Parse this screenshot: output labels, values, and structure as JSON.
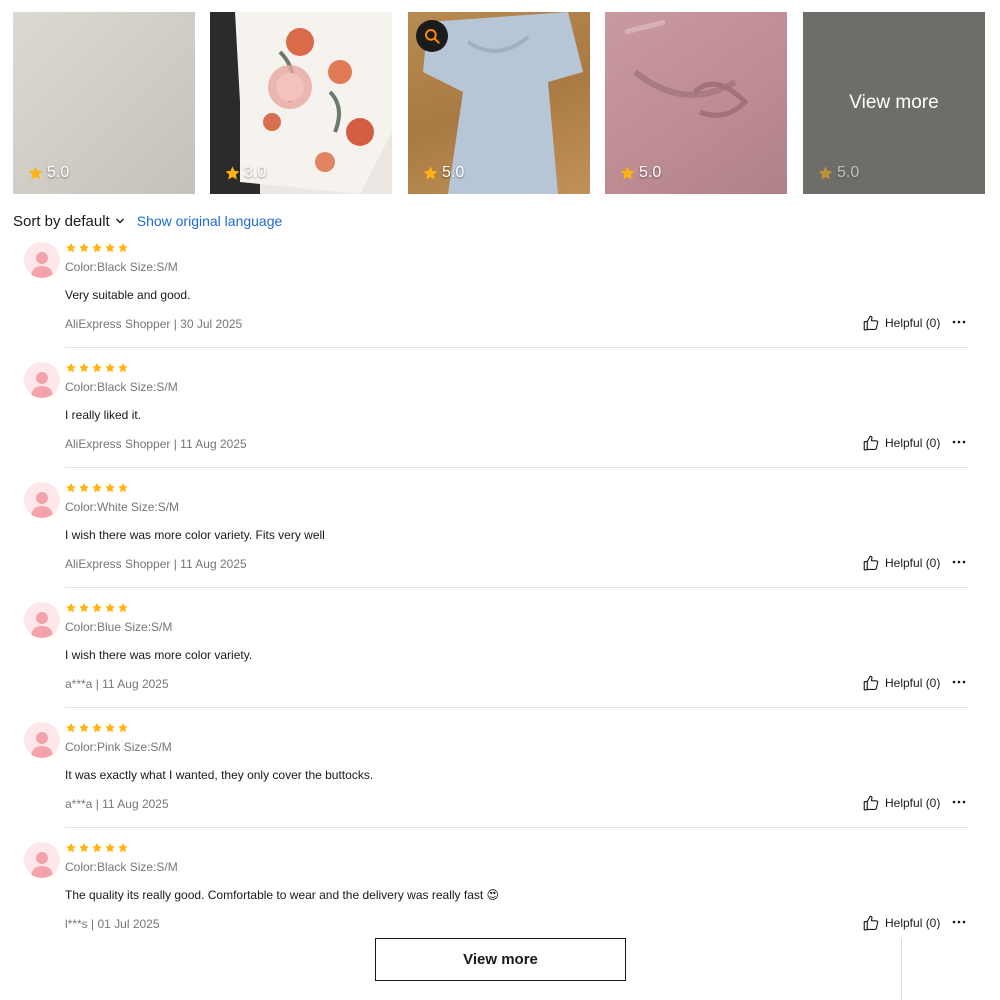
{
  "gallery": {
    "thumbnails": [
      {
        "rating": "5.0"
      },
      {
        "rating": "3.0"
      },
      {
        "rating": "5.0"
      },
      {
        "rating": "5.0"
      },
      {
        "rating": "5.0",
        "overlay_label": "View more"
      }
    ]
  },
  "toolbar": {
    "sort_label": "Sort by default",
    "show_original_label": "Show original language"
  },
  "colors": {
    "star": "#FFB30F",
    "link": "#1C6BD4",
    "avatar_bg": "#FDE7EA",
    "avatar_figure": "#F4A3AC"
  },
  "icons": [
    "star-icon",
    "chevron-down-icon",
    "search-icon",
    "user-avatar-icon",
    "thumbs-up-icon",
    "more-dots-icon"
  ],
  "reviews": [
    {
      "stars": 5,
      "variant": "Color:Black Size:S/M",
      "text": "Very suitable and good.",
      "meta": "AliExpress Shopper | 30 Jul 2025",
      "helpful": "Helpful (0)"
    },
    {
      "stars": 5,
      "variant": "Color:Black Size:S/M",
      "text": "I really liked it.",
      "meta": "AliExpress Shopper | 11 Aug 2025",
      "helpful": "Helpful (0)"
    },
    {
      "stars": 5,
      "variant": "Color:White Size:S/M",
      "text": "I wish there was more color variety. Fits very well",
      "meta": "AliExpress Shopper | 11 Aug 2025",
      "helpful": "Helpful (0)"
    },
    {
      "stars": 5,
      "variant": "Color:Blue Size:S/M",
      "text": "I wish there was more color variety.",
      "meta": "a***a | 11 Aug 2025",
      "helpful": "Helpful (0)"
    },
    {
      "stars": 5,
      "variant": "Color:Pink Size:S/M",
      "text": "It was exactly what I wanted, they only cover the buttocks.",
      "meta": "a***a | 11 Aug 2025",
      "helpful": "Helpful (0)"
    },
    {
      "stars": 5,
      "variant": "Color:Black Size:S/M",
      "text": "The quality its really good. Comfortable to wear and the delivery was really fast 😍",
      "meta": "l***s | 01 Jul 2025",
      "helpful": "Helpful (0)"
    }
  ],
  "footer": {
    "view_more_label": "View more"
  }
}
